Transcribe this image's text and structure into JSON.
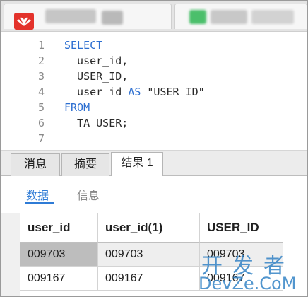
{
  "editor": {
    "lines": [
      {
        "num": "1",
        "kw": "SELECT",
        "text": ""
      },
      {
        "num": "2",
        "kw": "",
        "text": "  user_id,"
      },
      {
        "num": "3",
        "kw": "",
        "text": "  USER_ID,"
      },
      {
        "num": "4",
        "kw": "",
        "text": "  user_id ",
        "kw2": "AS",
        "tail": " \"USER_ID\""
      },
      {
        "num": "5",
        "kw": "FROM",
        "text": ""
      },
      {
        "num": "6",
        "kw": "",
        "text": "  TA_USER;"
      },
      {
        "num": "7",
        "kw": "",
        "text": ""
      }
    ]
  },
  "bottom_tabs": [
    "消息",
    "摘要",
    "结果 1"
  ],
  "sub_tabs": [
    "数据",
    "信息"
  ],
  "grid": {
    "headers": [
      "user_id",
      "user_id(1)",
      "USER_ID"
    ],
    "rows": [
      [
        "009703",
        "009703",
        "009703"
      ],
      [
        "009167",
        "009167",
        "009167"
      ]
    ]
  },
  "watermark": {
    "top": "开发者",
    "bottom": "DevZe.CoM"
  },
  "colors": {
    "keyword": "#2d6fd1",
    "accent": "#2e7bd6",
    "selected_cell": "#bdbdbd"
  }
}
